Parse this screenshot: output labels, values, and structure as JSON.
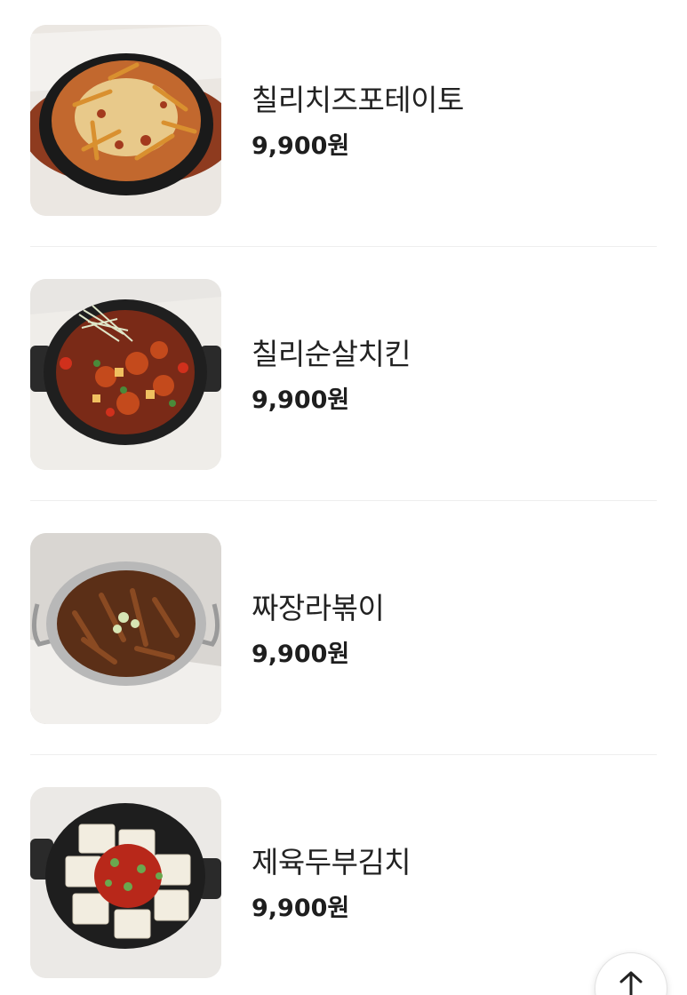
{
  "menu": {
    "items": [
      {
        "name": "칠리치즈포테이토",
        "price": "9,900원",
        "image_icon": "chili-cheese-potato-photo"
      },
      {
        "name": "칠리순살치킨",
        "price": "9,900원",
        "image_icon": "chili-boneless-chicken-photo"
      },
      {
        "name": "짜장라볶이",
        "price": "9,900원",
        "image_icon": "jjajang-rabokki-photo"
      },
      {
        "name": "제육두부김치",
        "price": "9,900원",
        "image_icon": "jeyuk-tofu-kimchi-photo"
      }
    ]
  },
  "scroll_top": {
    "icon": "arrow-up-icon"
  }
}
